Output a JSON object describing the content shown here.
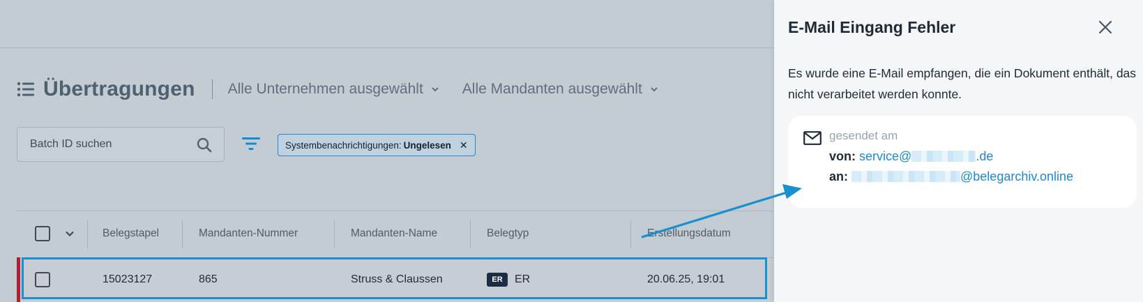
{
  "page": {
    "title": "Übertragungen",
    "company_filter": "Alle Unternehmen ausgewählt",
    "client_filter": "Alle Mandanten ausgewählt"
  },
  "search": {
    "placeholder": "Batch ID suchen"
  },
  "active_filter": {
    "label": "Systembenachrichtigungen:",
    "value": "Ungelesen"
  },
  "table": {
    "columns": [
      "Belegstapel",
      "Mandanten-Nummer",
      "Mandanten-Name",
      "Belegtyp",
      "Erstellungsdatum"
    ],
    "rows": [
      {
        "belegstapel": "15023127",
        "mandanten_nummer": "865",
        "mandanten_name": "Struss & Claussen",
        "belegtyp_badge": "ER",
        "belegtyp": "ER",
        "erstellungsdatum": "20.06.25, 19:01"
      }
    ]
  },
  "panel": {
    "title": "E-Mail Eingang Fehler",
    "description": "Es wurde eine E-Mail empfangen, die ein Dokument enthält, das nicht verarbeitet werden konnte.",
    "sent_label": "gesendet am",
    "from_label": "von:",
    "from_prefix": "service@",
    "from_suffix": ".de",
    "to_label": "an:",
    "to_suffix": "@belegarchiv.online"
  },
  "colors": {
    "accent": "#1a8fd0",
    "row_marker": "#b11f33",
    "badge_bg": "#1c2c44"
  },
  "icons": [
    "list-icon",
    "chevron-down-icon",
    "search-icon",
    "filter-icon",
    "close-icon",
    "mail-icon"
  ]
}
